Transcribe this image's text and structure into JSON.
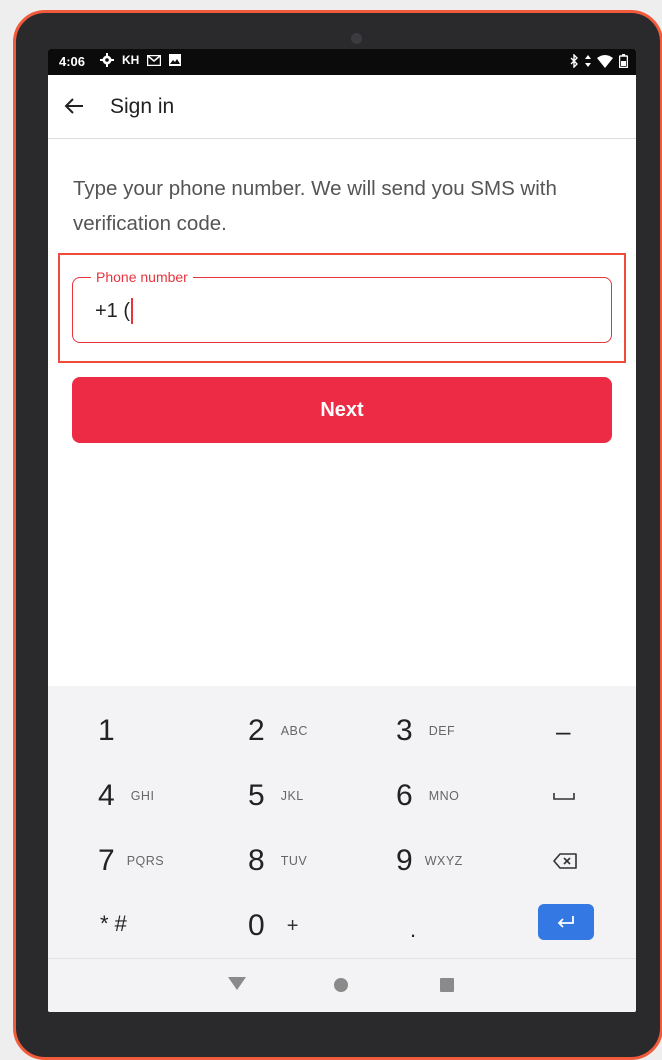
{
  "status_bar": {
    "time": "4:06",
    "left_icons": [
      "gear-icon",
      "kh-text",
      "mail-icon",
      "image-icon"
    ],
    "kh_label": "KH",
    "right_icons": [
      "bluetooth-icon",
      "wifi-icon",
      "battery-icon"
    ]
  },
  "app_bar": {
    "title": "Sign in"
  },
  "main": {
    "instruction": "Type your phone number. We will send you SMS with verification code.",
    "phone_field": {
      "label": "Phone number",
      "value": "+1 ("
    },
    "next_label": "Next"
  },
  "keyboard": {
    "rows": [
      [
        {
          "num": "1",
          "letters": ""
        },
        {
          "num": "2",
          "letters": "ABC"
        },
        {
          "num": "3",
          "letters": "DEF"
        },
        {
          "num": "–",
          "letters": ""
        }
      ],
      [
        {
          "num": "4",
          "letters": "GHI"
        },
        {
          "num": "5",
          "letters": "JKL"
        },
        {
          "num": "6",
          "letters": "MNO"
        },
        {
          "num": "",
          "letters": "",
          "icon": "space-icon"
        }
      ],
      [
        {
          "num": "7",
          "letters": "PQRS"
        },
        {
          "num": "8",
          "letters": "TUV"
        },
        {
          "num": "9",
          "letters": "WXYZ"
        },
        {
          "num": "",
          "letters": "",
          "icon": "backspace-icon"
        }
      ],
      [
        {
          "num": "* #",
          "letters": ""
        },
        {
          "num": "0",
          "letters": "+"
        },
        {
          "num": ".",
          "letters": ""
        },
        {
          "num": "",
          "letters": "",
          "icon": "enter-icon"
        }
      ]
    ]
  },
  "colors": {
    "accent": "#ee2b45",
    "device_frame": "#f15a3a",
    "enter_key": "#3478e4"
  }
}
